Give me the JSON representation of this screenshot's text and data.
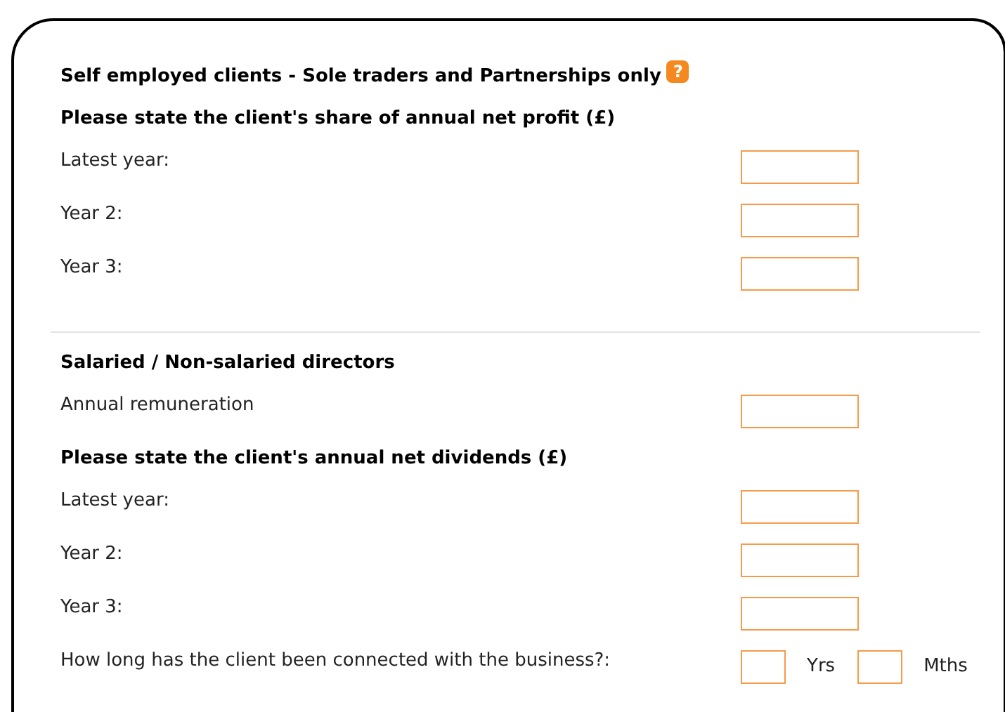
{
  "sections": [
    {
      "items": [
        {
          "kind": "heading",
          "label": "Self employed clients - Sole traders and Partnerships only",
          "help": "?"
        },
        {
          "kind": "heading",
          "label": "Please state the client's share of annual net profit (£)"
        },
        {
          "kind": "field",
          "label": "Latest year:"
        },
        {
          "kind": "field",
          "label": "Year 2:"
        },
        {
          "kind": "field",
          "label": "Year 3:"
        }
      ]
    },
    {
      "items": [
        {
          "kind": "heading",
          "label": "Salaried / Non-salaried directors"
        },
        {
          "kind": "field",
          "label": "Annual remuneration"
        },
        {
          "kind": "heading",
          "label": "Please state the client's annual net dividends (£)"
        },
        {
          "kind": "field",
          "label": "Latest year:"
        },
        {
          "kind": "field",
          "label": "Year 2:"
        },
        {
          "kind": "field",
          "label": "Year 3:"
        },
        {
          "kind": "duration",
          "label": "How long has the client been connected with the business?:",
          "units": [
            "Yrs",
            "Mths"
          ]
        }
      ]
    }
  ]
}
